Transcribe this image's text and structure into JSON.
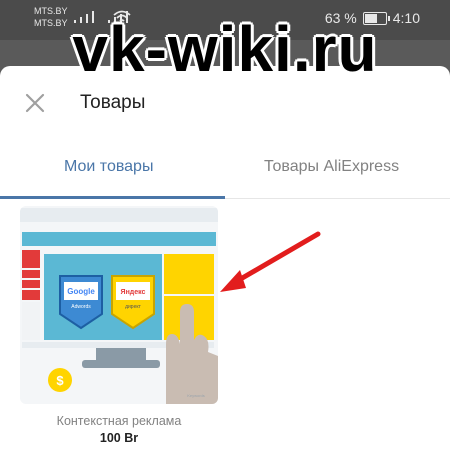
{
  "status_bar": {
    "carrier_1": "MTS.BY",
    "carrier_2": "MTS.BY",
    "battery_percent": "63 %",
    "battery_level": 0.63,
    "time": "4:10"
  },
  "watermark": "vk-wiki.ru",
  "header": {
    "title": "Товары",
    "close_icon": "close-icon"
  },
  "tabs": [
    {
      "label": "Мои товары",
      "active": true
    },
    {
      "label": "Товары AliExpress",
      "active": false
    }
  ],
  "products": [
    {
      "name": "Контекстная реклама",
      "price": "100 Br",
      "image_texts": {
        "google_logo": "Google",
        "google_sub": "Adwords",
        "yandex_logo": "Яндекс",
        "yandex_sub": "директ",
        "dollar": "$",
        "corner_mark": "Keywords"
      }
    }
  ],
  "colors": {
    "accent": "#4a76a8",
    "arrow": "#e21d1d",
    "overlay": "#5a5a5a"
  }
}
